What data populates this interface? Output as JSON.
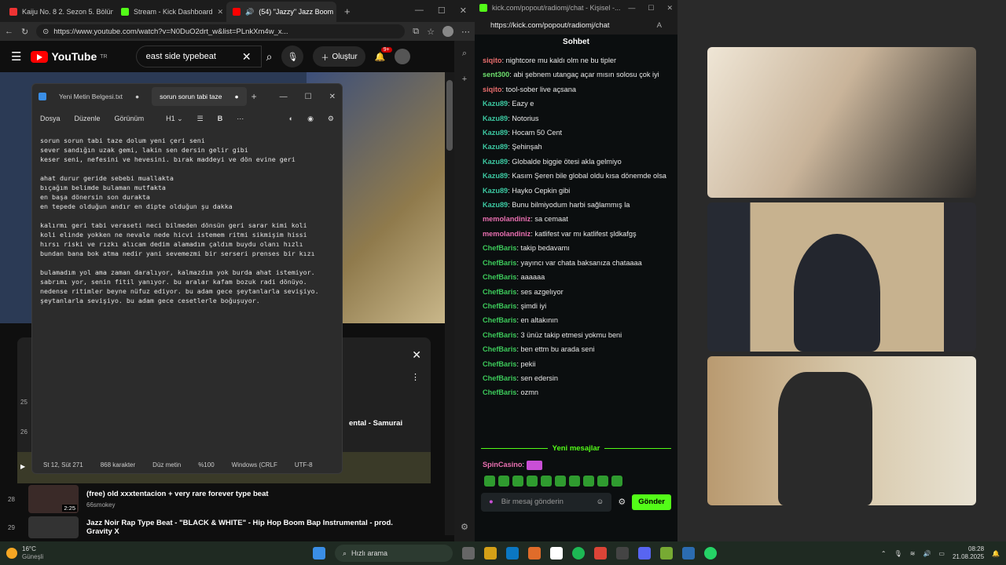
{
  "left_browser": {
    "tabs": [
      {
        "label": "Kaiju No. 8 2. Sezon 5. Bölüm",
        "color": "#e33"
      },
      {
        "label": "Stream - Kick Dashboard",
        "color": "#53fc18"
      },
      {
        "label": "(54) \"Jazzy\" Jazz Boom",
        "color": "#f00"
      }
    ],
    "url": "https://www.youtube.com/watch?v=N0DuO2drt_w&list=PLnkXm4w_x...",
    "youtube": {
      "logo": "YouTube",
      "region": "TR",
      "search_value": "east side typebeat",
      "create_label": "Oluştur",
      "notif_count": "9+"
    },
    "playlist": {
      "partial_title": "ental - Samurai",
      "items": [
        {
          "index": "28",
          "title": "(free) old xxxtentacion + very rare forever type beat",
          "channel": "66smokey",
          "duration": "2:25"
        },
        {
          "index": "29",
          "title": "Jazz Noir Rap Type Beat - \"BLACK & WHITE\" - Hip Hop Boom Bap Instrumental - prod. Gravity X",
          "channel": "",
          "duration": ""
        }
      ],
      "numbers": [
        "25",
        "26"
      ]
    }
  },
  "notepad": {
    "tabs": [
      "Yeni Metin Belgesi.txt",
      "sorun sorun tabi taze"
    ],
    "menu": [
      "Dosya",
      "Düzenle",
      "Görünüm"
    ],
    "heading_label": "H1",
    "text": "sorun sorun tabi taze dolum yeni çeri seni\nsever sandığın uzak gemi, lakin sen dersin gelir gibi\nkeser seni, nefesini ve hevesini. bırak maddeyi ve dön evine geri\n\nahat durur geride sebebi muallakta\nbıçağım belimde bulaman mutfakta\nen başa dönersin son durakta\nen tepede olduğun andır en dipte olduğun şu dakka\n\nkalırmı geri tabi veraseti neci bilmeden dönsün geri sarar kimi koli\nkoli elinde yokken ne nevale nede hicvi istemem ritmi sikmişim hissi\nhırsı riski ve rızkı alıcam dedim alamadım çaldım buydu olanı hızlı\nbundan bana bok atma nedir yani sevemezmi bir serseri prenses bir kızı\n\nbulamadım yol ama zaman daralıyor, kalmazdım yok burda ahat istemiyor.\nsabrımı yor, senin fitil yanıyor. bu aralar kafam bozuk radi dönüyo.\nnedense ritimler beyne nüfuz ediyor. bu adam gece şeytanlarla sevişiyo.\nşeytanlarla sevişiyo. bu adam gece cesetlerle boğuşuyor.",
    "status": [
      "St 12, Süt 271",
      "868 karakter",
      "Düz metin",
      "%100",
      "Windows (CRLF",
      "UTF-8"
    ]
  },
  "kick": {
    "window_title": "kick.com/popout/radiomj/chat - Kişisel -...",
    "url": "https://kick.com/popout/radiomj/chat",
    "header": "Sohbet",
    "messages": [
      {
        "user": "siqito",
        "text": "nightcore mu kaldı olm ne bu tipler",
        "color": "#e86d6d"
      },
      {
        "user": "sent300",
        "text": "abi şebnem utangaç açar mısın solosu çok iyi",
        "color": "#6ee06e"
      },
      {
        "user": "siqito",
        "text": "tool-sober live açsana",
        "color": "#e86d6d"
      },
      {
        "user": "Kazu89",
        "text": "Eazy e",
        "color": "#3cc9a2"
      },
      {
        "user": "Kazu89",
        "text": "Notorius",
        "color": "#3cc9a2"
      },
      {
        "user": "Kazu89",
        "text": "Hocam 50 Cent",
        "color": "#3cc9a2"
      },
      {
        "user": "Kazu89",
        "text": "Şehinşah",
        "color": "#3cc9a2"
      },
      {
        "user": "Kazu89",
        "text": "Globalde biggie ötesi akla gelmiyo",
        "color": "#3cc9a2"
      },
      {
        "user": "Kazu89",
        "text": "Kasım Şeren bile global oldu kısa dönemde olsa",
        "color": "#3cc9a2"
      },
      {
        "user": "Kazu89",
        "text": "Hayko Cepkin gibi",
        "color": "#3cc9a2"
      },
      {
        "user": "Kazu89",
        "text": "Bunu bilmiyodum harbi sağlammış la",
        "color": "#3cc9a2"
      },
      {
        "user": "memolandiniz",
        "text": "sa cemaat",
        "color": "#e86fb0"
      },
      {
        "user": "memolandiniz",
        "text": "katlifest var mı katlifest şldkafgş",
        "color": "#e86fb0"
      },
      {
        "user": "ChefBaris",
        "text": "takip bedavamı",
        "color": "#3cc95a"
      },
      {
        "user": "ChefBaris",
        "text": "yayıncı var chata baksanıza chataaaa",
        "color": "#3cc95a"
      },
      {
        "user": "ChefBaris",
        "text": "aaaaaa",
        "color": "#3cc95a"
      },
      {
        "user": "ChefBaris",
        "text": "ses azgelıyor",
        "color": "#3cc95a"
      },
      {
        "user": "ChefBaris",
        "text": "şimdi iyi",
        "color": "#3cc95a"
      },
      {
        "user": "ChefBaris",
        "text": "en altakının",
        "color": "#3cc95a"
      },
      {
        "user": "ChefBaris",
        "text": "3 ünüz takip etmesi yokmu beni",
        "color": "#3cc95a"
      },
      {
        "user": "ChefBaris",
        "text": "ben ettm bu arada seni",
        "color": "#3cc95a"
      },
      {
        "user": "ChefBaris",
        "text": "pekii",
        "color": "#3cc95a"
      },
      {
        "user": "ChefBaris",
        "text": "sen edersin",
        "color": "#3cc95a"
      },
      {
        "user": "ChefBaris",
        "text": "ozmn",
        "color": "#3cc95a"
      }
    ],
    "new_messages_label": "Yeni mesajlar",
    "last_user": "SpinCasino",
    "input_placeholder": "Bir mesaj gönderin",
    "send_label": "Gönder"
  },
  "taskbar": {
    "temp": "16°C",
    "weather": "Güneşli",
    "search_label": "Hızlı arama",
    "time": "08:28",
    "date": "21.08.2025"
  }
}
